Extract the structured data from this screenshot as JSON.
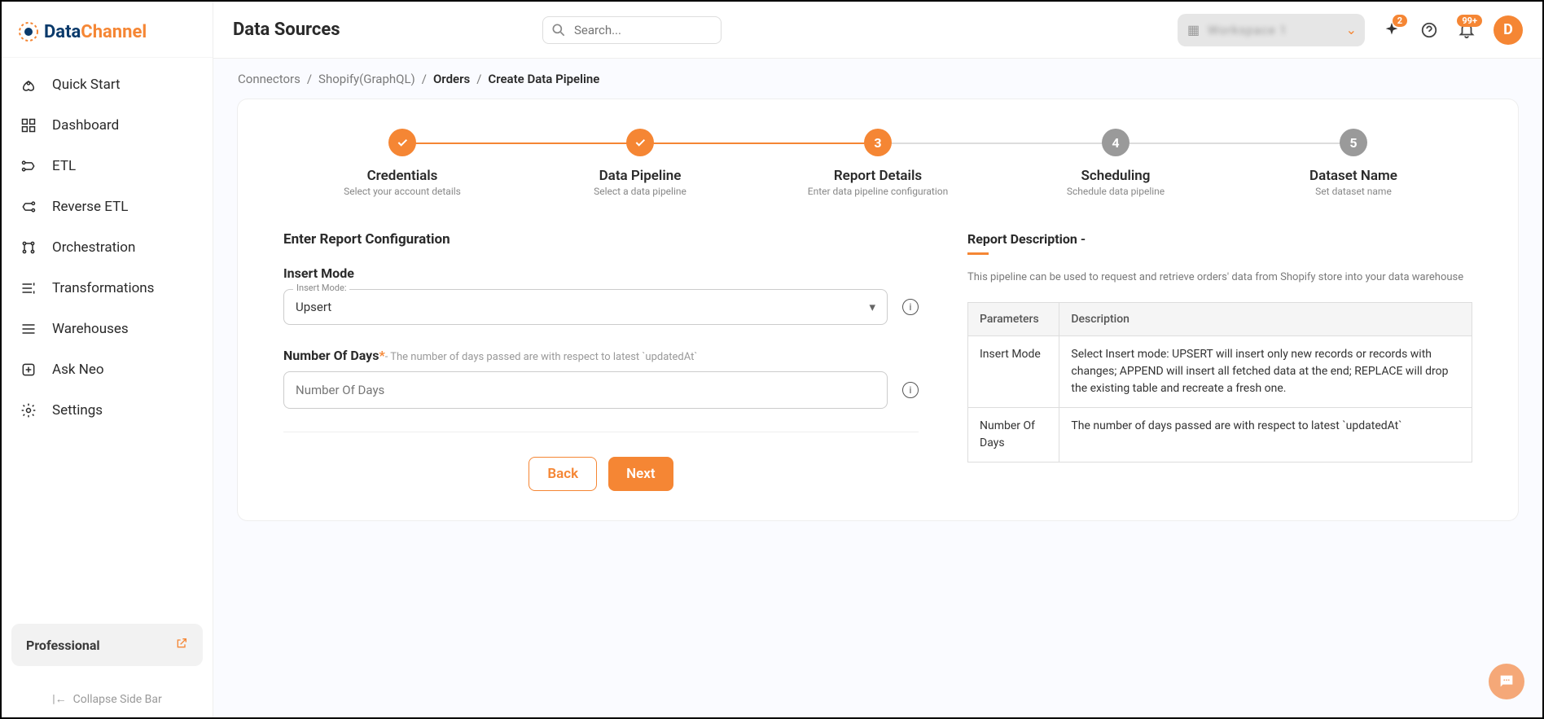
{
  "brand": {
    "part1": "Data",
    "part2": "Channel"
  },
  "header": {
    "title": "Data Sources",
    "search_placeholder": "Search...",
    "org": "Workspace 1",
    "ai_badge": "2",
    "bell_badge": "99+",
    "avatar_initial": "D"
  },
  "sidebar": {
    "items": [
      {
        "label": "Quick Start",
        "icon": "rocket"
      },
      {
        "label": "Dashboard",
        "icon": "grid"
      },
      {
        "label": "ETL",
        "icon": "etl"
      },
      {
        "label": "Reverse ETL",
        "icon": "reverse"
      },
      {
        "label": "Orchestration",
        "icon": "orch"
      },
      {
        "label": "Transformations",
        "icon": "trans"
      },
      {
        "label": "Warehouses",
        "icon": "ware"
      },
      {
        "label": "Ask Neo",
        "icon": "neo"
      },
      {
        "label": "Settings",
        "icon": "gear"
      }
    ],
    "plan": "Professional",
    "collapse": "Collapse Side Bar"
  },
  "breadcrumbs": [
    "Connectors",
    "Shopify(GraphQL)",
    "Orders",
    "Create Data Pipeline"
  ],
  "stepper": [
    {
      "title": "Credentials",
      "sub": "Select your account details",
      "status": "done"
    },
    {
      "title": "Data Pipeline",
      "sub": "Select a data pipeline",
      "status": "done"
    },
    {
      "title": "Report Details",
      "sub": "Enter data pipeline configuration",
      "status": "active",
      "num": "3"
    },
    {
      "title": "Scheduling",
      "sub": "Schedule data pipeline",
      "status": "inactive",
      "num": "4"
    },
    {
      "title": "Dataset Name",
      "sub": "Set dataset name",
      "status": "inactive",
      "num": "5"
    }
  ],
  "form": {
    "section_title": "Enter Report Configuration",
    "insert_mode_label": "Insert Mode",
    "insert_mode_float": "Insert Mode:",
    "insert_mode_value": "Upsert",
    "days_label": "Number Of Days",
    "days_hint": "- The number of days passed are with respect to latest `updatedAt`",
    "days_placeholder": "Number Of Days",
    "back": "Back",
    "next": "Next"
  },
  "description": {
    "title": "Report Description -",
    "text": "This pipeline can be used to request and retrieve orders' data from Shopify store into your data warehouse",
    "table_headers": [
      "Parameters",
      "Description"
    ],
    "rows": [
      {
        "param": "Insert Mode",
        "desc": "Select Insert mode: UPSERT will insert only new records or records with changes; APPEND will insert all fetched data at the end; REPLACE will drop the existing table and recreate a fresh one."
      },
      {
        "param": "Number Of Days",
        "desc": "The number of days passed are with respect to latest `updatedAt`"
      }
    ]
  }
}
